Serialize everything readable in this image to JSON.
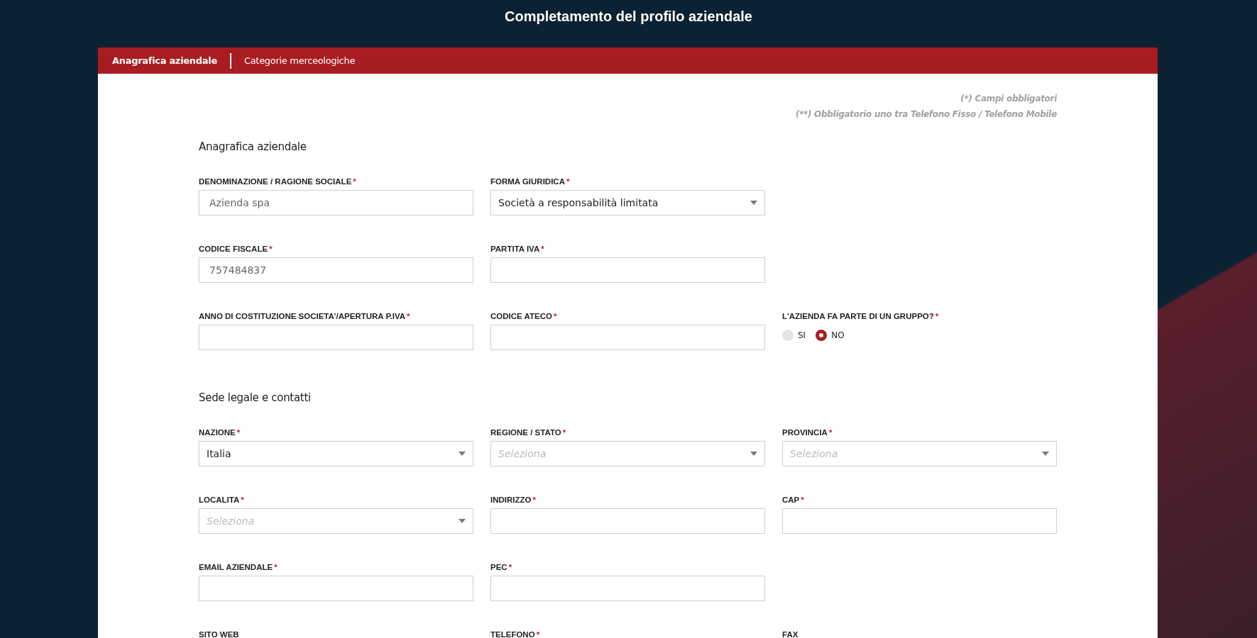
{
  "page_title": "Completamento del profilo aziendale",
  "tabs": [
    {
      "label": "Anagrafica aziendale",
      "selected": true
    },
    {
      "label": "Categorie merceologiche",
      "selected": false
    }
  ],
  "notes": [
    "(*) Campi obbligatori",
    "(**) Obbligatorio uno tra Telefono Fisso / Telefono Mobile"
  ],
  "sections": [
    {
      "title": "Anagrafica aziendale",
      "rows": [
        [
          {
            "kind": "text",
            "label": "DENOMINAZIONE / RAGIONE SOCIALE",
            "mark": "*",
            "value": "Azienda spa"
          },
          {
            "kind": "select",
            "label": "FORMA GIURIDICA",
            "mark": "*",
            "value": "Società a responsabilità limitata"
          }
        ],
        [
          {
            "kind": "text",
            "label": "CODICE FISCALE",
            "mark": "*",
            "value": "757484837"
          },
          {
            "kind": "text",
            "label": "PARTITA IVA",
            "mark": "*"
          }
        ],
        [
          {
            "kind": "text",
            "label": "ANNO DI COSTITUZIONE SOCIETA'/APERTURA P.IVA",
            "mark": "*"
          },
          {
            "kind": "text",
            "label": "CODICE ATECO",
            "mark": "*"
          },
          {
            "kind": "radio",
            "label": "L'AZIENDA FA PARTE DI UN GRUPPO?",
            "mark": "*",
            "options": [
              {
                "label": "SI",
                "selected": false
              },
              {
                "label": "NO",
                "selected": true
              }
            ]
          }
        ]
      ]
    },
    {
      "title": "Sede legale e contatti",
      "rows": [
        [
          {
            "kind": "select",
            "label": "NAZIONE",
            "mark": "*",
            "value": "Italia"
          },
          {
            "kind": "select",
            "label": "REGIONE / STATO",
            "mark": "*",
            "placeholder": "Seleziona"
          },
          {
            "kind": "select",
            "label": "PROVINCIA",
            "mark": "*",
            "placeholder": "Seleziona"
          }
        ],
        [
          {
            "kind": "select",
            "label": "LOCALITA",
            "mark": "*",
            "placeholder": "Seleziona"
          },
          {
            "kind": "text",
            "label": "INDIRIZZO",
            "mark": "*"
          },
          {
            "kind": "text",
            "label": "CAP",
            "mark": "*"
          }
        ],
        [
          {
            "kind": "text",
            "label": "EMAIL AZIENDALE",
            "mark": "*"
          },
          {
            "kind": "text",
            "label": "PEC",
            "mark": "*"
          }
        ],
        [
          {
            "kind": "label",
            "label": "SITO WEB"
          },
          {
            "kind": "label",
            "label": "TELEFONO",
            "mark": "*"
          },
          {
            "kind": "label",
            "label": "FAX"
          }
        ]
      ]
    }
  ]
}
